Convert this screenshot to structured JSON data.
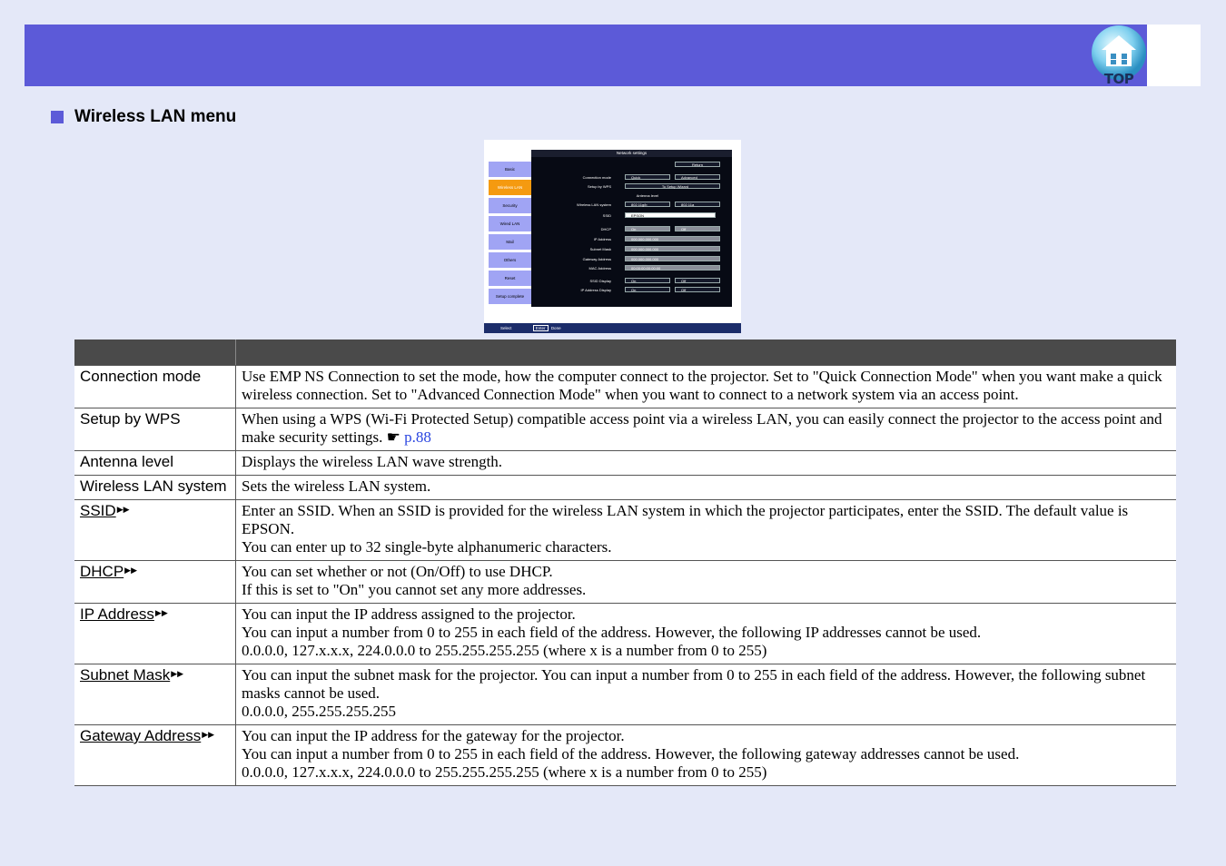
{
  "header": {
    "top_button_label": "TOP"
  },
  "section": {
    "title": "Wireless LAN menu"
  },
  "screenshot": {
    "panel_title": "Network settings",
    "menu": [
      "Basic",
      "Wireless LAN",
      "Security",
      "Wired LAN",
      "Mail",
      "Others",
      "Reset",
      "Setup complete"
    ],
    "return_label": "Return",
    "rows": {
      "connection_mode": {
        "label": "Connection mode",
        "opt1": "Quick",
        "opt2": "Advanced"
      },
      "setup_wps": {
        "label": "Setup by WPS",
        "value": "To Setup Wizard"
      },
      "antenna": {
        "label": "Antenna level"
      },
      "wlan_system": {
        "label": "Wireless LAN system",
        "opt1": "802.11g/b",
        "opt2": "802.11a"
      },
      "ssid": {
        "label": "SSID",
        "value": "EPSON"
      },
      "dhcp": {
        "label": "DHCP",
        "opt1": "On",
        "opt2": "Off"
      },
      "ip": {
        "label": "IP Address",
        "value": "000.000.000.000"
      },
      "subnet": {
        "label": "Subnet Mask",
        "value": "000.000.000.000"
      },
      "gateway": {
        "label": "Gateway Address",
        "value": "000.000.000.000"
      },
      "mac": {
        "label": "MAC Address",
        "value": "00:00:00:00:00:00"
      },
      "ssid_display": {
        "label": "SSID Display",
        "opt1": "On",
        "opt2": "Off"
      },
      "ip_display": {
        "label": "IP Address Display",
        "opt1": "On",
        "opt2": "Off"
      }
    },
    "footer": {
      "select": "Select",
      "enter": "Enter",
      "done": "Done"
    }
  },
  "table": {
    "rows": [
      {
        "term": "Connection mode",
        "lines": [
          "Use EMP NS Connection to set the mode, how the computer connect to the projector. Set to \"Quick Connection Mode\" when you want make a quick wireless connection. Set to \"Advanced Connection Mode\" when you want to connect to a network system via an access point."
        ]
      },
      {
        "term": "Setup by WPS",
        "lines": [
          "When using a WPS (Wi-Fi Protected Setup) compatible access point via a wireless LAN, you can easily connect the projector to the access point and make security settings."
        ],
        "link": "p.88"
      },
      {
        "term": "Antenna level",
        "lines": [
          "Displays the wireless LAN wave strength."
        ]
      },
      {
        "term": "Wireless LAN system",
        "lines": [
          "Sets the wireless LAN system."
        ]
      },
      {
        "term": "SSID",
        "glossary": true,
        "lines": [
          "Enter an SSID. When an SSID is provided for the wireless LAN system in which the projector participates, enter the SSID. The default value is EPSON.",
          "You can enter up to 32 single-byte alphanumeric characters."
        ]
      },
      {
        "term": "DHCP",
        "glossary": true,
        "lines": [
          "You can set whether or not (On/Off) to use DHCP.",
          "If this is set to \"On\" you cannot set any more addresses."
        ]
      },
      {
        "term": "IP Address",
        "glossary": true,
        "lines": [
          "You can input the IP address assigned to the projector.",
          "You can input a number from 0 to 255 in each field of the address. However, the following IP addresses cannot be used.",
          "0.0.0.0, 127.x.x.x, 224.0.0.0 to 255.255.255.255 (where x is a number from 0 to 255)"
        ]
      },
      {
        "term": "Subnet Mask",
        "glossary": true,
        "lines": [
          "You can input the subnet mask for the projector. You can input a number from 0 to 255 in each field of the address. However, the following subnet masks cannot be used.",
          "0.0.0.0, 255.255.255.255"
        ]
      },
      {
        "term": "Gateway Address",
        "glossary": true,
        "lines": [
          "You can input the IP address for the gateway for the projector.",
          "You can input a number from 0 to 255 in each field of the address. However, the following gateway addresses cannot be used.",
          "0.0.0.0, 127.x.x.x, 224.0.0.0 to 255.255.255.255 (where x is a number from 0 to 255)"
        ]
      }
    ]
  }
}
